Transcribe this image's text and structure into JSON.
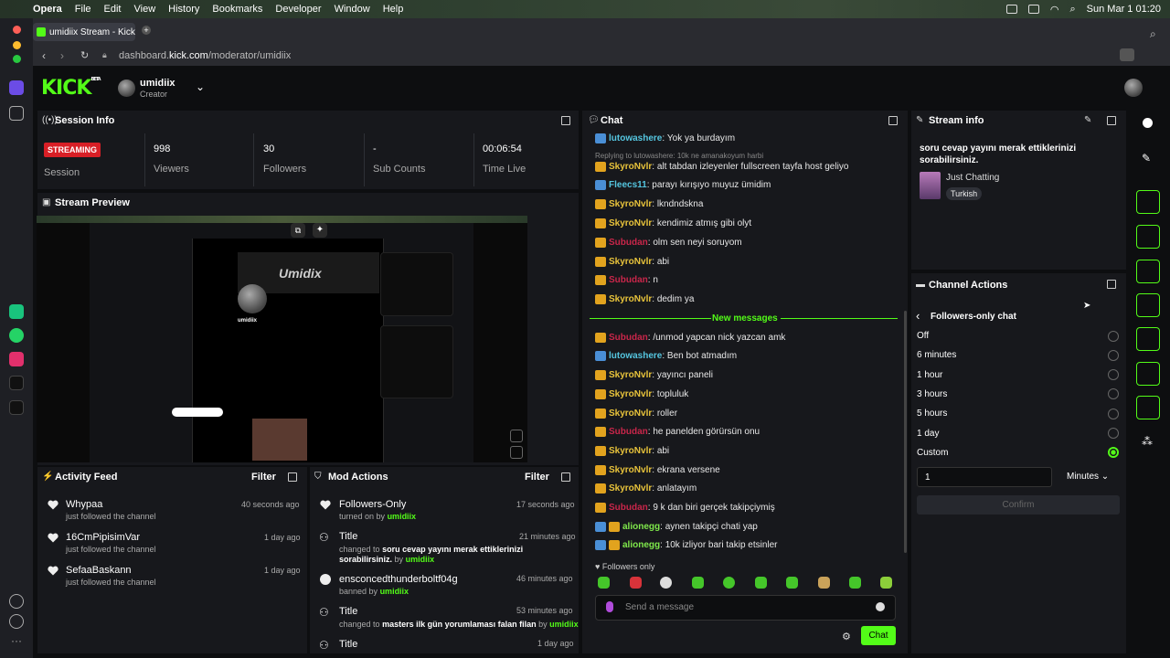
{
  "macbar": {
    "apple": "",
    "app": "Opera",
    "menus": [
      "File",
      "Edit",
      "View",
      "History",
      "Bookmarks",
      "Developer",
      "Window",
      "Help"
    ],
    "datetime": "Sun Mar 1  01:20"
  },
  "browser": {
    "tab_title": "umidiix Stream - Kick Da",
    "url_pre": "dashboard.",
    "url_host": "kick.com",
    "url_path": "/moderator/umidiix"
  },
  "header": {
    "logo": "KICK",
    "beta": "BETA",
    "channel": "umidiix",
    "role": "Creator"
  },
  "session": {
    "title": "Session Info",
    "badge": "STREAMING",
    "session_label": "Session",
    "viewers": "998",
    "viewers_label": "Viewers",
    "followers": "30",
    "followers_label": "Followers",
    "subs": "-",
    "subs_label": "Sub Counts",
    "time": "00:06:54",
    "time_label": "Time Live"
  },
  "preview": {
    "title": "Stream Preview",
    "profile_name": "umidiix",
    "banner": "Umidix"
  },
  "activity": {
    "title": "Activity Feed",
    "filter": "Filter",
    "items": [
      {
        "name": "Whypaa",
        "sub": "just followed the channel",
        "time": "40 seconds ago"
      },
      {
        "name": "16CmPipisimVar",
        "sub": "just followed the channel",
        "time": "1 day ago"
      },
      {
        "name": "SefaaBaskann",
        "sub": "just followed the channel",
        "time": "1 day ago"
      }
    ]
  },
  "mod": {
    "title": "Mod Actions",
    "filter": "Filter",
    "items": [
      {
        "title": "Followers-Only",
        "sub": "turned on by",
        "by": "umidiix",
        "time": "17 seconds ago"
      },
      {
        "title": "Title",
        "sub": "changed to",
        "detail": "soru cevap yayını merak ettiklerinizi sorabilirsiniz.",
        "by_pre": "by",
        "by": "umidiix",
        "time": "21 minutes ago"
      },
      {
        "title": "ensconcedthunderboltf04g",
        "sub": "banned by",
        "by": "umidiix",
        "time": "46 minutes ago"
      },
      {
        "title": "Title",
        "sub": "changed to",
        "detail": "masters ilk gün yorumlaması falan filan",
        "by_pre": "by",
        "by": "umidiix",
        "time": "53 minutes ago"
      },
      {
        "title": "Title",
        "time": "1 day ago"
      }
    ]
  },
  "chat": {
    "title": "Chat",
    "reply_note": "Replying to lutowashere: 10k ne amanakoyum harbi",
    "new_messages": "New messages",
    "followers_only": "Followers only",
    "placeholder": "Send a message",
    "send": "Chat",
    "lines": [
      {
        "u": "lutowashere",
        "m": "Yok ya burdayım"
      },
      {
        "u": "SkyroNvlr",
        "m": "alt tabdan izleyenler fullscreen tayfa host geliyo"
      },
      {
        "u": "Fleecs11",
        "m": "parayı kırışıyo muyuz ümidim"
      },
      {
        "u": "SkyroNvlr",
        "m": "lkndndskna"
      },
      {
        "u": "SkyroNvlr",
        "m": "kendimiz atmış gibi olyt"
      },
      {
        "u": "Subudan",
        "m": "olm sen neyi soruyom"
      },
      {
        "u": "SkyroNvlr",
        "m": "abi"
      },
      {
        "u": "Subudan",
        "m": "n"
      },
      {
        "u": "SkyroNvlr",
        "m": "dedim ya"
      },
      {
        "u": "Subudan",
        "m": "/unmod yapcan nick yazcan amk"
      },
      {
        "u": "lutowashere",
        "m": "Ben bot atmadım"
      },
      {
        "u": "SkyroNvlr",
        "m": "yayıncı paneli"
      },
      {
        "u": "SkyroNvlr",
        "m": "topluluk"
      },
      {
        "u": "SkyroNvlr",
        "m": "roller"
      },
      {
        "u": "Subudan",
        "m": "he panelden görürsün onu"
      },
      {
        "u": "SkyroNvlr",
        "m": "abi"
      },
      {
        "u": "SkyroNvlr",
        "m": "ekrana versene"
      },
      {
        "u": "SkyroNvlr",
        "m": "anlatayım"
      },
      {
        "u": "Subudan",
        "m": "9 k dan biri gerçek takipçiymiş"
      },
      {
        "u": "alionegg",
        "m": "aynen takipçi chati yap"
      },
      {
        "u": "alionegg",
        "m": "10k izliyor bari takip etsinler"
      }
    ]
  },
  "stream_info": {
    "title": "Stream info",
    "stream_title": "soru cevap yayını merak ettiklerinizi sorabilirsiniz.",
    "category": "Just Chatting",
    "tag": "Turkish"
  },
  "channel_actions": {
    "title": "Channel Actions",
    "back": "Followers-only chat",
    "options": [
      "Off",
      "6 minutes",
      "1 hour",
      "3 hours",
      "5 hours",
      "1 day",
      "Custom"
    ],
    "selected": "Custom",
    "custom_value": "1",
    "unit": "Minutes",
    "confirm": "Confirm"
  },
  "colors": {
    "accent": "#53fc18",
    "streaming": "#d81f26",
    "panel": "#17181c"
  }
}
